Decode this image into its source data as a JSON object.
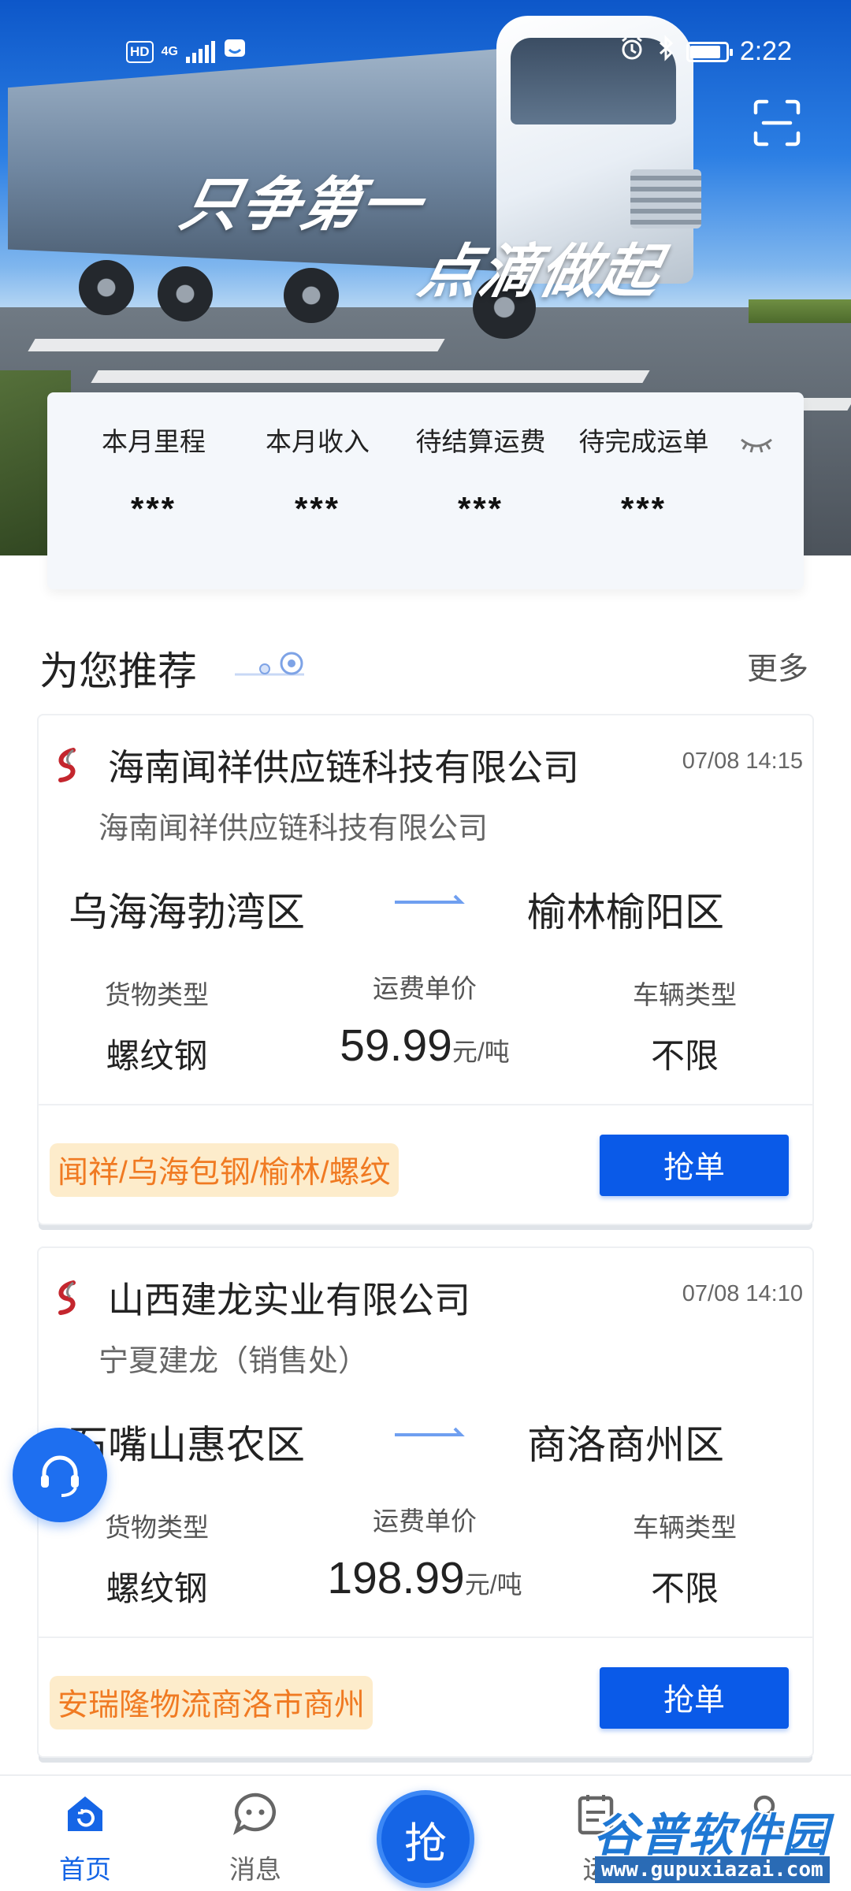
{
  "status_bar": {
    "hd": "HD",
    "network": "4G",
    "time": "2:22",
    "icons": [
      "signal-icon",
      "huawei-share-icon",
      "alarm-icon",
      "bluetooth-icon",
      "battery-icon"
    ]
  },
  "banner": {
    "slogan_line1": "只争第一",
    "slogan_line2": "点滴做起"
  },
  "stats": [
    {
      "label": "本月里程",
      "value": "***"
    },
    {
      "label": "本月收入",
      "value": "***"
    },
    {
      "label": "待结算运费",
      "value": "***"
    },
    {
      "label": "待完成运单",
      "value": "***"
    }
  ],
  "section": {
    "title": "为您推荐",
    "more": "更多"
  },
  "orders": [
    {
      "company": "海南闻祥供应链科技有限公司",
      "time": "07/08 14:15",
      "sub_company": "海南闻祥供应链科技有限公司",
      "from": "乌海海勃湾区",
      "to": "榆林榆阳区",
      "cargo_label": "货物类型",
      "cargo": "螺纹钢",
      "price_label": "运费单价",
      "price": "59.99",
      "price_unit": "元/吨",
      "vehicle_label": "车辆类型",
      "vehicle": "不限",
      "tag": "闻祥/乌海包钢/榆林/螺纹",
      "button": "抢单"
    },
    {
      "company": "山西建龙实业有限公司",
      "time": "07/08 14:10",
      "sub_company": "宁夏建龙（销售处）",
      "from": "石嘴山惠农区",
      "to": "商洛商州区",
      "cargo_label": "货物类型",
      "cargo": "螺纹钢",
      "price_label": "运费单价",
      "price": "198.99",
      "price_unit": "元/吨",
      "vehicle_label": "车辆类型",
      "vehicle": "不限",
      "tag": "安瑞隆物流商洛市商州",
      "button": "抢单"
    }
  ],
  "nav": {
    "home": "首页",
    "messages": "消息",
    "center": "抢",
    "waybill": "运"
  },
  "watermark": {
    "title": "谷普软件园",
    "url": "www.gupuxiazai.com"
  },
  "colors": {
    "primary": "#0a5ae8",
    "tag_bg": "#fdeccb",
    "tag_text": "#f07a22",
    "nav_active": "#1565e6"
  }
}
